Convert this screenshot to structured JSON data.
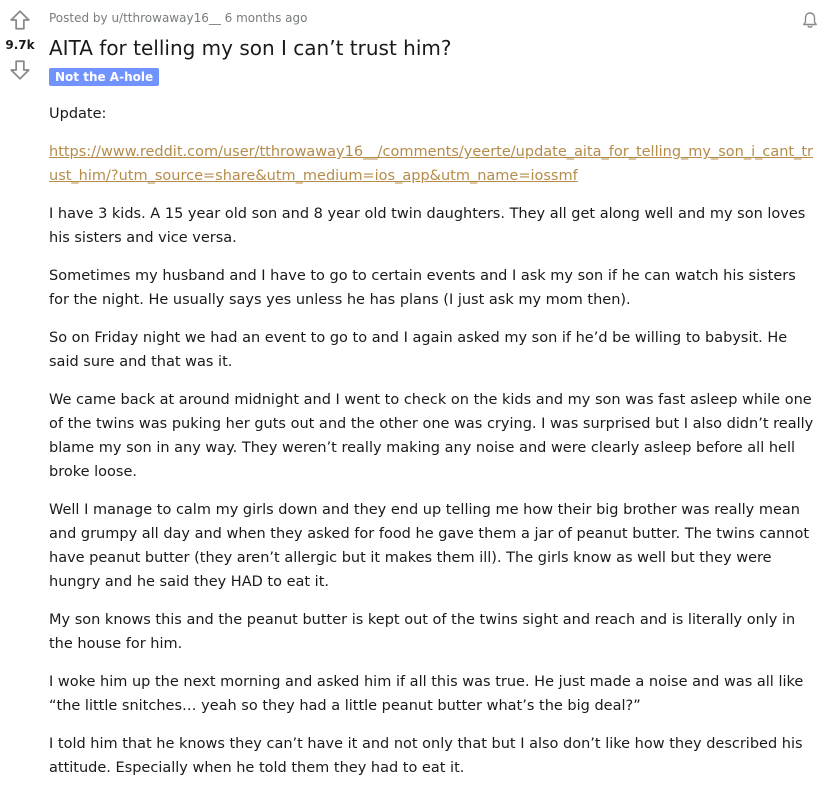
{
  "post": {
    "meta": {
      "posted_by": "Posted by u/tthrowaway16__",
      "time": "6 months ago"
    },
    "score": "9.7k",
    "title": "AITA for telling my son I can’t trust him?",
    "flair": "Not the A-hole",
    "flair_color": "#7193ff",
    "update_label": "Update:",
    "update_link": "https://www.reddit.com/user/tthrowaway16__/comments/yeerte/update_aita_for_telling_my_son_i_cant_trust_him/?utm_source=share&utm_medium=ios_app&utm_name=iossmf",
    "paragraphs": [
      "I have 3 kids. A 15 year old son and 8 year old twin daughters. They all get along well and my son loves his sisters and vice versa.",
      "Sometimes my husband and I have to go to certain events and I ask my son if he can watch his sisters for the night. He usually says yes unless he has plans (I just ask my mom then).",
      "So on Friday night we had an event to go to and I again asked my son if he’d be willing to babysit. He said sure and that was it.",
      "We came back at around midnight and I went to check on the kids and my son was fast asleep while one of the twins was puking her guts out and the other one was crying. I was surprised but I also didn’t really blame my son in any way. They weren’t really making any noise and were clearly asleep before all hell broke loose.",
      "Well I manage to calm my girls down and they end up telling me how their big brother was really mean and grumpy all day and when they asked for food he gave them a jar of peanut butter. The twins cannot have peanut butter (they aren’t allergic but it makes them ill). The girls know as well but they were hungry and he said they HAD to eat it.",
      "My son knows this and the peanut butter is kept out of the twins sight and reach and is literally only in the house for him.",
      "I woke him up the next morning and asked him if all this was true. He just made a noise and was all like “the little snitches… yeah so they had a little peanut butter what’s the big deal?”",
      "I told him that he knows they can’t have it and not only that but I also don’t like how they described his attitude. Especially when he told them they had to eat it."
    ]
  },
  "icons": {
    "upvote": "upvote-arrow-icon",
    "downvote": "downvote-arrow-icon",
    "notify": "bell-icon"
  },
  "colors": {
    "link": "#b58c4a",
    "meta": "#787c7e"
  }
}
